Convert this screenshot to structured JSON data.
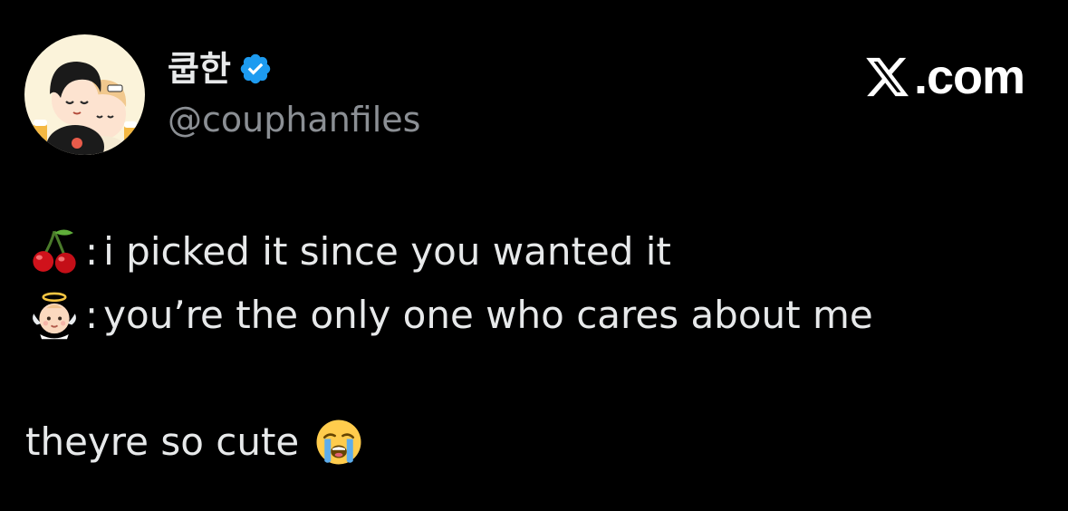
{
  "user": {
    "display_name": "쿱한",
    "handle": "@couphanfiles",
    "verified": true
  },
  "brand": {
    "label": ".com"
  },
  "tweet": {
    "lines": [
      {
        "speaker_icon": "cherries-emoji",
        "separator": ":",
        "text": "i picked it since you wanted it"
      },
      {
        "speaker_icon": "baby-angel-emoji",
        "separator": ":",
        "text": "you’re the only one who cares about me"
      }
    ],
    "comment": "theyre so cute",
    "comment_emoji": "loudly-crying-face-emoji"
  },
  "colors": {
    "background": "#000000",
    "text": "#e7e9ea",
    "secondary_text": "#8b8f94",
    "verified_badge": "#1d9bf0"
  }
}
